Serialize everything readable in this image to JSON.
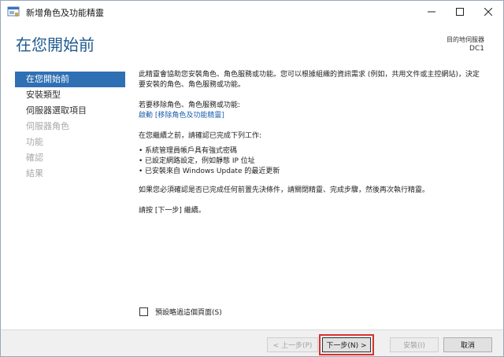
{
  "window": {
    "title": "新增角色及功能精靈"
  },
  "header": {
    "page_title": "在您開始前",
    "destination_label": "目的地伺服器",
    "destination_value": "DC1"
  },
  "nav": {
    "items": [
      {
        "label": "在您開始前",
        "state": "active"
      },
      {
        "label": "安裝類型",
        "state": "normal"
      },
      {
        "label": "伺服器選取項目",
        "state": "normal"
      },
      {
        "label": "伺服器角色",
        "state": "disabled"
      },
      {
        "label": "功能",
        "state": "disabled"
      },
      {
        "label": "確認",
        "state": "disabled"
      },
      {
        "label": "結果",
        "state": "disabled"
      }
    ]
  },
  "content": {
    "intro": "此精靈會協助您安裝角色、角色服務或功能。您可以根據組織的資訊需求 (例如，共用文件或主控網站)，決定要安裝的角色、角色服務或功能。",
    "remove_prompt": "若要移除角色、角色服務或功能:",
    "remove_link_prefix": "啟動 ",
    "remove_link": "[移除角色及功能精靈]",
    "before_continue": "在您繼續之前，請確認已完成下列工作:",
    "tasks": [
      "系統管理員帳戶具有強式密碼",
      "已設定網路設定，例如靜態 IP 位址",
      "已安裝來自 Windows Update 的最近更新"
    ],
    "verify_note": "如果您必須確認是否已完成任何前置先決條件，請關閉精靈、完成步驟，然後再次執行精靈。",
    "continue_note": "請按 [下一步] 繼續。"
  },
  "skip_page": {
    "label": "預設略過這個頁面(S)",
    "checked": false
  },
  "buttons": {
    "prev": "< 上一步(P)",
    "next": "下一步(N) >",
    "install": "安裝(I)",
    "cancel": "取消"
  },
  "colors": {
    "accent": "#2f6fb4",
    "title": "#1f5a8e",
    "highlight": "#d6322f"
  }
}
